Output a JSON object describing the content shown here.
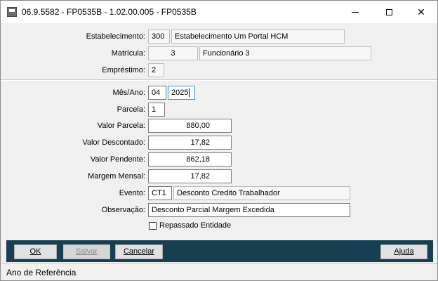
{
  "window": {
    "title": "06.9.5582 - FP0535B - 1.02.00.005 - FP0535B",
    "minimize_glyph": "—",
    "close_glyph": "✕"
  },
  "header_section": {
    "estabelecimento": {
      "label": "Estabelecimento:",
      "code": "300",
      "name": "Estabelecimento Um Portal HCM"
    },
    "matricula": {
      "label": "Matrícula:",
      "code": "3",
      "name": "Funcionário 3"
    },
    "emprestimo": {
      "label": "Empréstimo:",
      "value": "2"
    }
  },
  "detail_section": {
    "mes_ano": {
      "label": "Mês/Ano:",
      "month": "04",
      "year": "2025"
    },
    "parcela": {
      "label": "Parcela:",
      "value": "1"
    },
    "valor_parcela": {
      "label": "Valor Parcela:",
      "value": "880,00"
    },
    "valor_descontado": {
      "label": "Valor Descontado:",
      "value": "17,82"
    },
    "valor_pendente": {
      "label": "Valor Pendente:",
      "value": "862,18"
    },
    "margem_mensal": {
      "label": "Margem Mensal:",
      "value": "17,82"
    },
    "evento": {
      "label": "Evento:",
      "code": "CT1",
      "name": "Desconto Credito Trabalhador"
    },
    "observacao": {
      "label": "Observação:",
      "value": "Desconto Parcial Margem Excedida"
    },
    "repassado": {
      "label": "Repassado Entidade",
      "checked": false
    }
  },
  "buttons": {
    "ok": "OK",
    "salvar": "Salvar",
    "cancelar": "Cancelar",
    "ajuda": "Ajuda"
  },
  "status_bar": {
    "text": "Ano de Referência"
  }
}
